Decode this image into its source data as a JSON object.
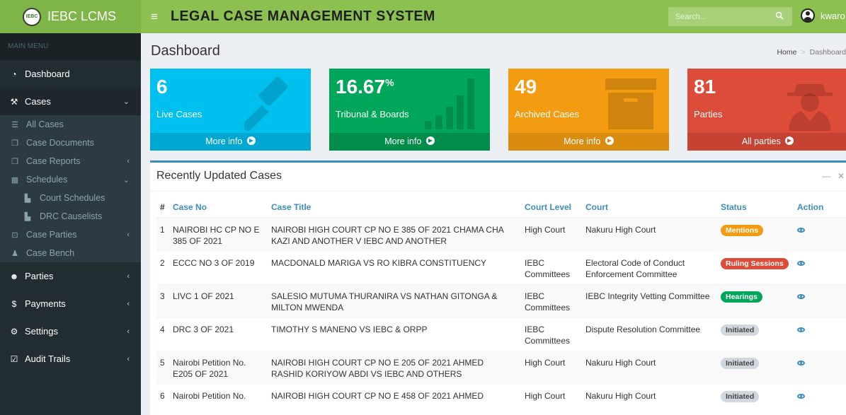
{
  "header": {
    "logo_badge": "IEBC",
    "app_name": "IEBC LCMS",
    "system_title": "LEGAL CASE MANAGEMENT SYSTEM",
    "search_placeholder": "Search...",
    "user_name": "kwaro",
    "menu_icon": "hamburger-icon"
  },
  "sidebar": {
    "menu_header": "MAIN MENU",
    "dashboard": "Dashboard",
    "cases": "Cases",
    "all_cases": "All Cases",
    "case_documents": "Case Documents",
    "case_reports": "Case Reports",
    "schedules": "Schedules",
    "court_schedules": "Court Schedules",
    "drc_causelists": "DRC Causelists",
    "case_parties": "Case Parties",
    "case_bench": "Case Bench",
    "parties": "Parties",
    "payments": "Payments",
    "settings": "Settings",
    "audit_trails": "Audit Trails"
  },
  "page": {
    "title": "Dashboard",
    "breadcrumb_home": "Home",
    "breadcrumb_current": "Dashboard"
  },
  "stats": [
    {
      "value": "6",
      "suffix": "",
      "label": "Live Cases",
      "footer": "More info",
      "color": "#00c0ef",
      "icon": "gavel-icon"
    },
    {
      "value": "16.67",
      "suffix": "%",
      "label": "Tribunal & Boards",
      "footer": "More info",
      "color": "#00a65a",
      "icon": "bar-chart-icon"
    },
    {
      "value": "49",
      "suffix": "",
      "label": "Archived Cases",
      "footer": "More info",
      "color": "#f39c12",
      "icon": "archive-icon"
    },
    {
      "value": "81",
      "suffix": "",
      "label": "Parties",
      "footer": "All parties",
      "color": "#dd4b39",
      "icon": "user-secret-icon"
    }
  ],
  "recent": {
    "title": "Recently Updated Cases",
    "columns": [
      "#",
      "Case No",
      "Case Title",
      "Court Level",
      "Court",
      "Status",
      "Action"
    ],
    "rows": [
      {
        "n": "1",
        "case_no": "NAIROBI HC CP NO E 385 OF 2021",
        "title": "NAIROBI HIGH COURT CP NO E 385 OF 2021 CHAMA CHA KAZI AND ANOTHER V IEBC AND ANOTHER",
        "level": "High Court",
        "court": "Nakuru High Court",
        "status": "Mentions",
        "status_color": "#f39c12"
      },
      {
        "n": "2",
        "case_no": "ECCC NO 3 OF 2019",
        "title": "MACDONALD MARIGA VS RO KIBRA CONSTITUENCY",
        "level": "IEBC Committees",
        "court": "Electoral Code of Conduct Enforcement Committee",
        "status": "Ruling Sessions",
        "status_color": "#dd4b39"
      },
      {
        "n": "3",
        "case_no": "LIVC 1 OF 2021",
        "title": "SALESIO MUTUMA THURANIRA VS NATHAN GITONGA & MILTON MWENDA",
        "level": "IEBC Committees",
        "court": "IEBC Integrity Vetting Committee",
        "status": "Hearings",
        "status_color": "#00a65a"
      },
      {
        "n": "4",
        "case_no": "DRC 3 OF 2021",
        "title": "TIMOTHY S MANENO VS IEBC & ORPP",
        "level": "IEBC Committees",
        "court": "Dispute Resolution Committee",
        "status": "Initiated",
        "status_color": "#d2d6de"
      },
      {
        "n": "5",
        "case_no": "Nairobi Petition No. E205 OF 2021",
        "title": "NAIROBI HIGH COURT CP NO E 205 OF 2021 AHMED RASHID KORIYOW ABDI VS IEBC AND OTHERS",
        "level": "High Court",
        "court": "Nakuru High Court",
        "status": "Initiated",
        "status_color": "#d2d6de"
      },
      {
        "n": "6",
        "case_no": "Nairobi Petition No.",
        "title": "NAIROBI HIGH COURT CP NO E 458 OF 2021 AHMED",
        "level": "High Court",
        "court": "Nakuru High Court",
        "status": "Initiated",
        "status_color": "#d2d6de"
      }
    ]
  }
}
